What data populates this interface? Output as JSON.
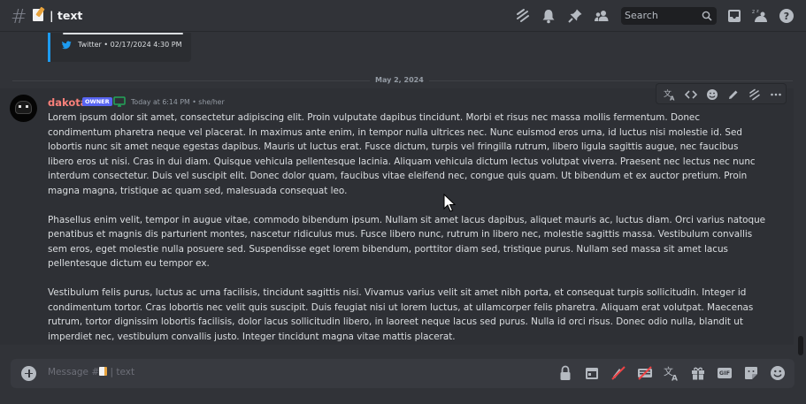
{
  "header": {
    "channel_title": "| text",
    "search_placeholder": "Search"
  },
  "embed": {
    "footer": "Twitter • 02/17/2024 4:30 PM"
  },
  "divider": {
    "date": "May 2, 2024"
  },
  "message": {
    "author": "dakota",
    "badge": "OWNER",
    "timestamp": "Today at 6:14 PM • she/her",
    "paragraphs": [
      "Lorem ipsum dolor sit amet, consectetur adipiscing elit. Proin vulputate dapibus tincidunt. Morbi et risus nec massa mollis fermentum. Donec condimentum pharetra neque vel placerat. In maximus ante enim, in tempor nulla ultrices nec. Nunc euismod eros urna, id luctus nisi molestie id. Sed lobortis nunc sit amet neque egestas dapibus. Mauris ut luctus erat. Fusce dictum, turpis vel fringilla rutrum, libero ligula sagittis augue, nec faucibus libero eros ut nisi. Cras in dui diam. Quisque vehicula pellentesque lacinia. Aliquam vehicula dictum lectus volutpat viverra. Praesent nec lectus nec nunc interdum consectetur. Duis vel suscipit elit. Donec dolor quam, faucibus vitae eleifend nec, congue quis quam. Ut bibendum et ex auctor pretium. Proin magna magna, tristique ac quam sed, malesuada consequat leo.",
      "Phasellus enim velit, tempor in augue vitae, commodo bibendum ipsum. Nullam sit amet lacus dapibus, aliquet mauris ac, luctus diam. Orci varius natoque penatibus et magnis dis parturient montes, nascetur ridiculus mus. Fusce libero nunc, rutrum in libero nec, molestie sagittis massa. Vestibulum convallis sem eros, eget molestie nulla posuere sed. Suspendisse eget lorem bibendum, porttitor diam sed, tristique purus. Nullam sed massa sit amet lacus pellentesque dictum eu tempor ex.",
      "Vestibulum felis purus, luctus ac urna facilisis, tincidunt sagittis nisi. Vivamus varius velit sit amet nibh porta, et consequat turpis sollicitudin. Integer id condimentum tortor. Cras lobortis nec velit quis suscipit. Duis feugiat nisi ut lorem luctus, at ullamcorper felis pharetra. Aliquam erat volutpat. Maecenas rutrum, tortor dignissim lobortis facilisis, dolor lacus sollicitudin libero, in laoreet neque lacus sed purus. Nulla id orci risus. Donec odio nulla, blandit ut imperdiet nec, vestibulum convallis justo. Integer tincidunt magna vitae mattis placerat."
    ]
  },
  "composer": {
    "placeholder_prefix": "Message #",
    "placeholder_suffix": " | text",
    "gif_label": "GIF"
  },
  "colors": {
    "background": "#313338",
    "author": "#f9807a",
    "badge": "#5865f2",
    "twitter_accent": "#1d9bf0",
    "monitor": "#23a55a"
  },
  "icons": {
    "header": [
      "hashtag-icon",
      "threads-icon",
      "bell-icon",
      "pin-icon",
      "members-icon",
      "search-icon",
      "inbox-icon",
      "sleep-icon",
      "help-icon"
    ],
    "toolbar": [
      "translate-icon",
      "code-icon",
      "emoji-icon",
      "edit-icon",
      "thread-icon",
      "more-icon"
    ],
    "composer": [
      "add-icon",
      "lock-icon",
      "calendar-icon",
      "mute-icon",
      "keyboard-icon",
      "translate-icon",
      "gift-icon",
      "gif-icon",
      "sticker-icon",
      "emoji-icon"
    ]
  }
}
